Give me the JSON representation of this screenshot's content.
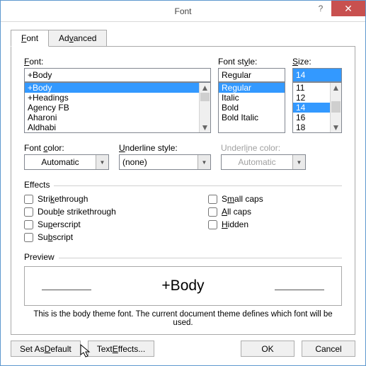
{
  "titlebar": {
    "title": "Font"
  },
  "tabs": {
    "font": "Font",
    "advanced": "Advanced"
  },
  "labels": {
    "font": "Font:",
    "fontHot": "F",
    "style": "Font style:",
    "styleHot": "y",
    "size": "Size:",
    "sizeHot": "S",
    "color": "Font color:",
    "uline": "Underline style:",
    "ulinecolor": "Underline color:",
    "effects": "Effects",
    "preview": "Preview"
  },
  "font": {
    "value": "+Body",
    "items": [
      "+Body",
      "+Headings",
      "Agency FB",
      "Aharoni",
      "Aldhabi"
    ]
  },
  "style": {
    "value": "Regular",
    "items": [
      "Regular",
      "Italic",
      "Bold",
      "Bold Italic"
    ]
  },
  "size": {
    "value": "14",
    "items": [
      "11",
      "12",
      "14",
      "16",
      "18"
    ]
  },
  "color": {
    "value": "Automatic"
  },
  "uline": {
    "value": "(none)"
  },
  "ulinecolor": {
    "value": "Automatic"
  },
  "effects": {
    "strike": "Strikethrough",
    "strikeHot": "k",
    "dstrike": "Double strikethrough",
    "dstrikeHot": "l",
    "supers": "Superscript",
    "supersHot": "p",
    "subs": "Subscript",
    "subsHot": "b",
    "smallcaps": "Small caps",
    "smallcapsHot": "m",
    "allcaps": "All caps",
    "allcapsHot": "A",
    "hidden": "Hidden",
    "hiddenHot": "H"
  },
  "preview": {
    "text": "+Body",
    "hint": "This is the body theme font. The current document theme defines which font will be used."
  },
  "buttons": {
    "setdefault": "Set As Default",
    "setdefaultHot": "D",
    "texteffects": "Text Effects...",
    "texteffectsHot": "e",
    "ok": "OK",
    "cancel": "Cancel"
  }
}
